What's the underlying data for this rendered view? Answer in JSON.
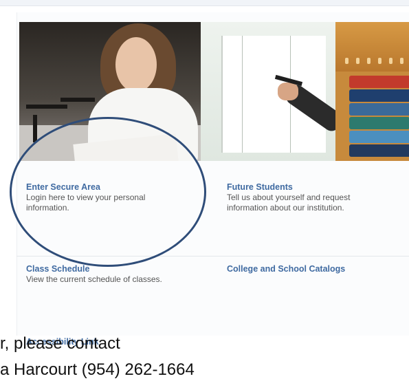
{
  "tiles": [
    {
      "title": "Enter Secure Area",
      "desc_line1": "Login here to view your personal",
      "desc_line2": "information."
    },
    {
      "title": "Future Students",
      "desc_line1": "Tell us about yourself and request",
      "desc_line2": "information about our institution."
    },
    {
      "title": "Class Schedule",
      "desc_line1": "View the current schedule of classes.",
      "desc_line2": ""
    },
    {
      "title": "College and School Catalogs",
      "desc_line1": "",
      "desc_line2": ""
    },
    {
      "title": "Accessibility Link",
      "desc_line1": "",
      "desc_line2": ""
    }
  ],
  "caption": {
    "line1": "r, please contact",
    "line2": "a Harcourt (954) 262-1664"
  },
  "colors": {
    "link": "#3f6aa1",
    "highlight_oval": "#2f4d79"
  }
}
